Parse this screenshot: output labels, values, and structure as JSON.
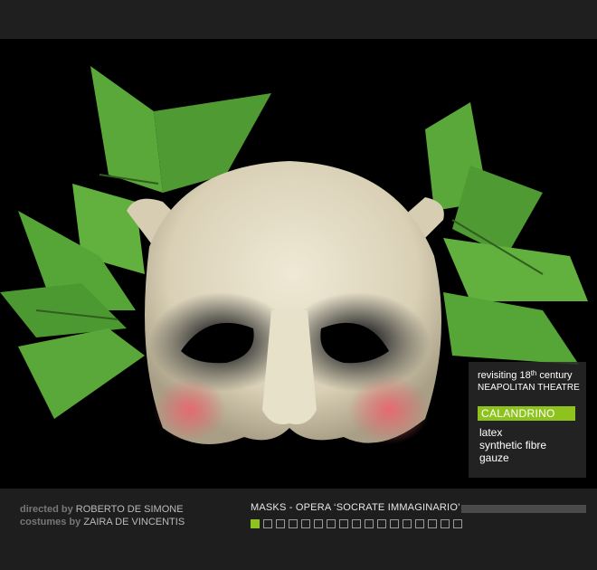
{
  "caption": {
    "line1_pre": "revisiting 18",
    "line1_sup": "th",
    "line1_post": " century",
    "line2": "NEAPOLITAN THEATRE",
    "name": "CALANDRINO",
    "materials": [
      "latex",
      "synthetic fibre",
      "gauze"
    ]
  },
  "credits": [
    {
      "role": "directed by",
      "person": "ROBERTO DE SIMONE"
    },
    {
      "role": "costumes by",
      "person": "ZAIRA DE VINCENTIS"
    }
  ],
  "section_title": "MASKS  -  OPERA ‘SOCRATE IMMAGINARIO’",
  "progress": {
    "fraction": 0.0
  },
  "pager": {
    "total": 17,
    "current": 1
  },
  "colors": {
    "accent": "#8dc21f",
    "background": "#1e1e1e",
    "photo_bg": "#000000"
  },
  "image": {
    "subject": "mask-photo"
  }
}
